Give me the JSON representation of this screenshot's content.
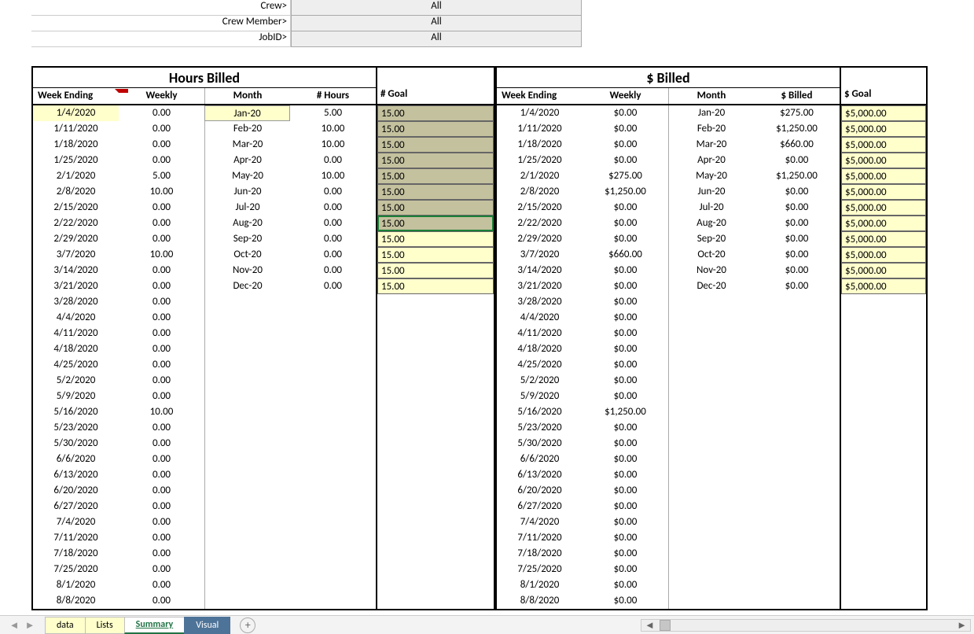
{
  "filters": [
    {
      "label": "Crew>",
      "value": "All"
    },
    {
      "label": "Crew Member>",
      "value": "All"
    },
    {
      "label": "JobID>",
      "value": "All"
    }
  ],
  "hours": {
    "title": "Hours Billed",
    "headers": {
      "we": "Week Ending",
      "wk": "Weekly",
      "mo": "Month",
      "hr": "# Hours"
    },
    "goal_header": "# Goal",
    "weeks": [
      {
        "we": "1/4/2020",
        "wk": "0.00"
      },
      {
        "we": "1/11/2020",
        "wk": "0.00"
      },
      {
        "we": "1/18/2020",
        "wk": "0.00"
      },
      {
        "we": "1/25/2020",
        "wk": "0.00"
      },
      {
        "we": "2/1/2020",
        "wk": "5.00"
      },
      {
        "we": "2/8/2020",
        "wk": "10.00"
      },
      {
        "we": "2/15/2020",
        "wk": "0.00"
      },
      {
        "we": "2/22/2020",
        "wk": "0.00"
      },
      {
        "we": "2/29/2020",
        "wk": "0.00"
      },
      {
        "we": "3/7/2020",
        "wk": "10.00"
      },
      {
        "we": "3/14/2020",
        "wk": "0.00"
      },
      {
        "we": "3/21/2020",
        "wk": "0.00"
      },
      {
        "we": "3/28/2020",
        "wk": "0.00"
      },
      {
        "we": "4/4/2020",
        "wk": "0.00"
      },
      {
        "we": "4/11/2020",
        "wk": "0.00"
      },
      {
        "we": "4/18/2020",
        "wk": "0.00"
      },
      {
        "we": "4/25/2020",
        "wk": "0.00"
      },
      {
        "we": "5/2/2020",
        "wk": "0.00"
      },
      {
        "we": "5/9/2020",
        "wk": "0.00"
      },
      {
        "we": "5/16/2020",
        "wk": "10.00"
      },
      {
        "we": "5/23/2020",
        "wk": "0.00"
      },
      {
        "we": "5/30/2020",
        "wk": "0.00"
      },
      {
        "we": "6/6/2020",
        "wk": "0.00"
      },
      {
        "we": "6/13/2020",
        "wk": "0.00"
      },
      {
        "we": "6/20/2020",
        "wk": "0.00"
      },
      {
        "we": "6/27/2020",
        "wk": "0.00"
      },
      {
        "we": "7/4/2020",
        "wk": "0.00"
      },
      {
        "we": "7/11/2020",
        "wk": "0.00"
      },
      {
        "we": "7/18/2020",
        "wk": "0.00"
      },
      {
        "we": "7/25/2020",
        "wk": "0.00"
      },
      {
        "we": "8/1/2020",
        "wk": "0.00"
      },
      {
        "we": "8/8/2020",
        "wk": "0.00"
      }
    ],
    "months": [
      {
        "mo": "Jan-20",
        "hr": "5.00",
        "goal": "15.00",
        "gclass": "olive"
      },
      {
        "mo": "Feb-20",
        "hr": "10.00",
        "goal": "15.00",
        "gclass": "olive"
      },
      {
        "mo": "Mar-20",
        "hr": "10.00",
        "goal": "15.00",
        "gclass": "olive"
      },
      {
        "mo": "Apr-20",
        "hr": "0.00",
        "goal": "15.00",
        "gclass": "olive"
      },
      {
        "mo": "May-20",
        "hr": "10.00",
        "goal": "15.00",
        "gclass": "olive"
      },
      {
        "mo": "Jun-20",
        "hr": "0.00",
        "goal": "15.00",
        "gclass": "olive"
      },
      {
        "mo": "Jul-20",
        "hr": "0.00",
        "goal": "15.00",
        "gclass": "olive"
      },
      {
        "mo": "Aug-20",
        "hr": "0.00",
        "goal": "15.00",
        "gclass": "olive sel"
      },
      {
        "mo": "Sep-20",
        "hr": "0.00",
        "goal": "15.00",
        "gclass": "yellow"
      },
      {
        "mo": "Oct-20",
        "hr": "0.00",
        "goal": "15.00",
        "gclass": "yellow"
      },
      {
        "mo": "Nov-20",
        "hr": "0.00",
        "goal": "15.00",
        "gclass": "yellow"
      },
      {
        "mo": "Dec-20",
        "hr": "0.00",
        "goal": "15.00",
        "gclass": "yellow"
      }
    ]
  },
  "dollars": {
    "title": "$ Billed",
    "headers": {
      "we": "Week Ending",
      "wk": "Weekly",
      "mo": "Month",
      "hr": "$ Billed"
    },
    "goal_header": "$ Goal",
    "weeks": [
      {
        "we": "1/4/2020",
        "wk": "$0.00"
      },
      {
        "we": "1/11/2020",
        "wk": "$0.00"
      },
      {
        "we": "1/18/2020",
        "wk": "$0.00"
      },
      {
        "we": "1/25/2020",
        "wk": "$0.00"
      },
      {
        "we": "2/1/2020",
        "wk": "$275.00"
      },
      {
        "we": "2/8/2020",
        "wk": "$1,250.00"
      },
      {
        "we": "2/15/2020",
        "wk": "$0.00"
      },
      {
        "we": "2/22/2020",
        "wk": "$0.00"
      },
      {
        "we": "2/29/2020",
        "wk": "$0.00"
      },
      {
        "we": "3/7/2020",
        "wk": "$660.00"
      },
      {
        "we": "3/14/2020",
        "wk": "$0.00"
      },
      {
        "we": "3/21/2020",
        "wk": "$0.00"
      },
      {
        "we": "3/28/2020",
        "wk": "$0.00"
      },
      {
        "we": "4/4/2020",
        "wk": "$0.00"
      },
      {
        "we": "4/11/2020",
        "wk": "$0.00"
      },
      {
        "we": "4/18/2020",
        "wk": "$0.00"
      },
      {
        "we": "4/25/2020",
        "wk": "$0.00"
      },
      {
        "we": "5/2/2020",
        "wk": "$0.00"
      },
      {
        "we": "5/9/2020",
        "wk": "$0.00"
      },
      {
        "we": "5/16/2020",
        "wk": "$1,250.00"
      },
      {
        "we": "5/23/2020",
        "wk": "$0.00"
      },
      {
        "we": "5/30/2020",
        "wk": "$0.00"
      },
      {
        "we": "6/6/2020",
        "wk": "$0.00"
      },
      {
        "we": "6/13/2020",
        "wk": "$0.00"
      },
      {
        "we": "6/20/2020",
        "wk": "$0.00"
      },
      {
        "we": "6/27/2020",
        "wk": "$0.00"
      },
      {
        "we": "7/4/2020",
        "wk": "$0.00"
      },
      {
        "we": "7/11/2020",
        "wk": "$0.00"
      },
      {
        "we": "7/18/2020",
        "wk": "$0.00"
      },
      {
        "we": "7/25/2020",
        "wk": "$0.00"
      },
      {
        "we": "8/1/2020",
        "wk": "$0.00"
      },
      {
        "we": "8/8/2020",
        "wk": "$0.00"
      }
    ],
    "months": [
      {
        "mo": "Jan-20",
        "hr": "$275.00",
        "goal": "$5,000.00"
      },
      {
        "mo": "Feb-20",
        "hr": "$1,250.00",
        "goal": "$5,000.00"
      },
      {
        "mo": "Mar-20",
        "hr": "$660.00",
        "goal": "$5,000.00"
      },
      {
        "mo": "Apr-20",
        "hr": "$0.00",
        "goal": "$5,000.00"
      },
      {
        "mo": "May-20",
        "hr": "$1,250.00",
        "goal": "$5,000.00"
      },
      {
        "mo": "Jun-20",
        "hr": "$0.00",
        "goal": "$5,000.00"
      },
      {
        "mo": "Jul-20",
        "hr": "$0.00",
        "goal": "$5,000.00"
      },
      {
        "mo": "Aug-20",
        "hr": "$0.00",
        "goal": "$5,000.00"
      },
      {
        "mo": "Sep-20",
        "hr": "$0.00",
        "goal": "$5,000.00"
      },
      {
        "mo": "Oct-20",
        "hr": "$0.00",
        "goal": "$5,000.00"
      },
      {
        "mo": "Nov-20",
        "hr": "$0.00",
        "goal": "$5,000.00"
      },
      {
        "mo": "Dec-20",
        "hr": "$0.00",
        "goal": "$5,000.00"
      }
    ]
  },
  "tabs": [
    {
      "label": "data",
      "cls": "y"
    },
    {
      "label": "Lists",
      "cls": "y"
    },
    {
      "label": "Summary",
      "cls": "active"
    },
    {
      "label": "Visual",
      "cls": "dark"
    }
  ]
}
